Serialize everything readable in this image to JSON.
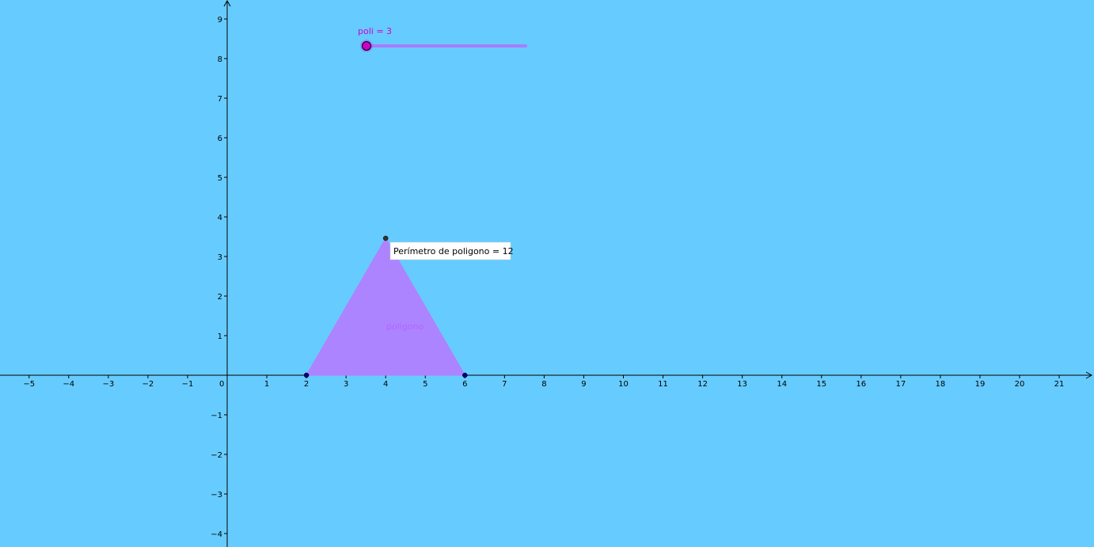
{
  "colors": {
    "background": "#66ccff",
    "axis": "#000000",
    "polygon_fill": "#b57cff",
    "polygon_label": "#b266ff",
    "slider_label": "#cc00cc",
    "slider_track": "#a87cff",
    "slider_knob": "#cc00cc",
    "vertex": "#00007f",
    "apex_vertex": "#333333",
    "caption_bg": "#ffffff"
  },
  "axes": {
    "x_ticks": [
      "-5",
      "-4",
      "-3",
      "-2",
      "-1",
      "0",
      "1",
      "2",
      "3",
      "4",
      "5",
      "6",
      "7",
      "8",
      "9",
      "10",
      "11",
      "12",
      "13",
      "14",
      "15",
      "16",
      "17",
      "18",
      "19",
      "20",
      "21"
    ],
    "y_ticks": [
      "9",
      "8",
      "7",
      "6",
      "5",
      "4",
      "3",
      "2",
      "1",
      "-1",
      "-2",
      "-3",
      "-4"
    ]
  },
  "slider": {
    "label": "poli = 3",
    "value": 3
  },
  "polygon": {
    "label": "poligono",
    "vertices": [
      [
        2,
        0
      ],
      [
        6,
        0
      ],
      [
        4,
        3.46
      ]
    ]
  },
  "caption": {
    "text": "Perímetro de poligono = 12"
  }
}
